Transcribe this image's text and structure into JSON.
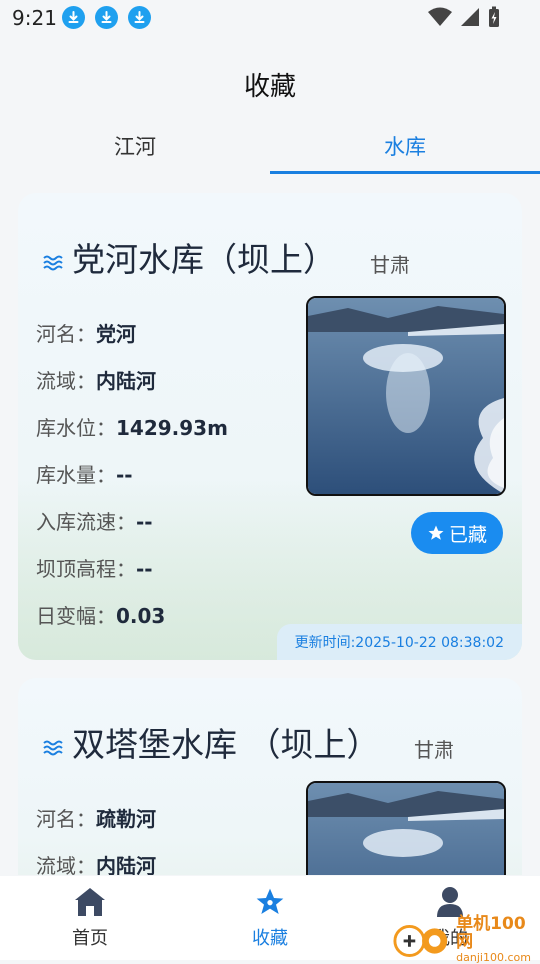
{
  "status_bar": {
    "time": "9:21"
  },
  "header": {
    "title": "收藏"
  },
  "tabs": [
    {
      "label": "江河",
      "active": false
    },
    {
      "label": "水库",
      "active": true
    }
  ],
  "cards": [
    {
      "name": "党河水库（坝上）",
      "province": "甘肃",
      "fields": [
        {
          "label": "河名：",
          "value": "党河"
        },
        {
          "label": "流域：",
          "value": "内陆河"
        },
        {
          "label": "库水位：",
          "value": "1429.93m"
        },
        {
          "label": "库水量：",
          "value": "--"
        },
        {
          "label": "入库流速：",
          "value": "--"
        },
        {
          "label": "坝顶高程：",
          "value": "--"
        },
        {
          "label": "日变幅：",
          "value": "0.03"
        }
      ],
      "favorite_label": "已藏",
      "update_time": "更新时间:2025-10-22 08:38:02"
    },
    {
      "name": "双塔堡水库 （坝上）",
      "province": "甘肃",
      "fields": [
        {
          "label": "河名：",
          "value": "疏勒河"
        },
        {
          "label": "流域：",
          "value": "内陆河"
        }
      ]
    }
  ],
  "bottom_nav": [
    {
      "label": "首页",
      "icon": "home-icon",
      "active": false
    },
    {
      "label": "收藏",
      "icon": "star-icon",
      "active": true
    },
    {
      "label": "我的",
      "icon": "user-icon",
      "active": false
    }
  ],
  "watermark": {
    "text": "单机100网",
    "url_text": "danji100.com"
  },
  "colors": {
    "accent": "#1a7fe0",
    "button": "#1a8cf0",
    "download_badge": "#1fa0ef"
  }
}
